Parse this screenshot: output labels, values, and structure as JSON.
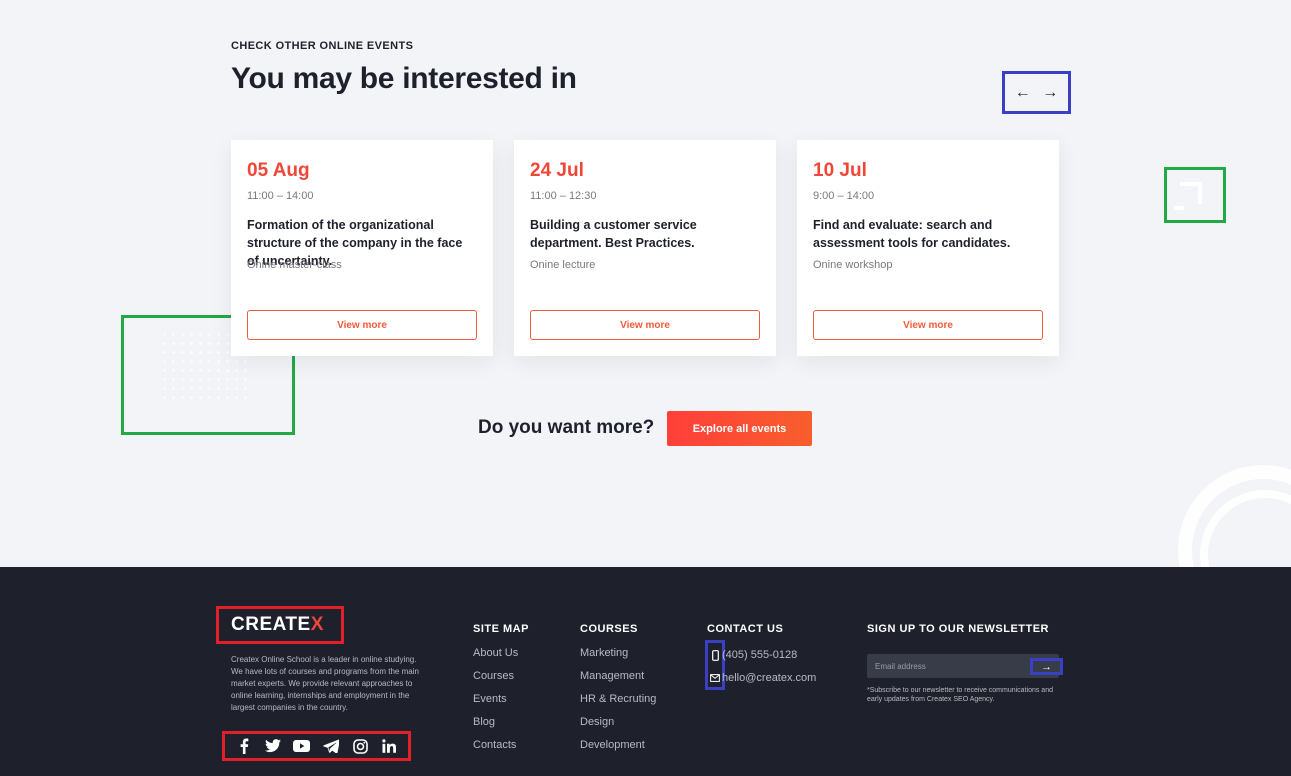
{
  "events_section": {
    "eyebrow": "CHECK OTHER ONLINE EVENTS",
    "heading": "You may be interested in",
    "nav": {
      "prev_icon": "←",
      "next_icon": "→"
    },
    "cards": [
      {
        "date": "05 Aug",
        "time": "11:00 – 14:00",
        "title": "Formation of the organizational structure of the company in the face of uncertainty.",
        "type": "Onine master-class",
        "button": "View more"
      },
      {
        "date": "24 Jul",
        "time": "11:00 – 12:30",
        "title": "Building a customer service department. Best Practices.",
        "type": "Onine lecture",
        "button": "View more"
      },
      {
        "date": "10 Jul",
        "time": "9:00 – 14:00",
        "title": "Find and evaluate: search and assessment tools for candidates.",
        "type": "Onine workshop",
        "button": "View more"
      }
    ],
    "more_question": "Do you want more?",
    "explore_button": "Explore all events"
  },
  "footer": {
    "logo_main": "CREATE",
    "logo_x": "X",
    "about": "Createx Online School is a leader in online studying. We have lots of courses and programs from the main market experts. We provide relevant approaches to online learning, internships and employment in the largest companies in the country.",
    "social": [
      "facebook-icon",
      "twitter-icon",
      "youtube-icon",
      "telegram-icon",
      "instagram-icon",
      "linkedin-icon"
    ],
    "site_map": {
      "title": "SITE MAP",
      "items": [
        "About Us",
        "Courses",
        "Events",
        "Blog",
        "Contacts"
      ]
    },
    "courses": {
      "title": "COURSES",
      "items": [
        "Marketing",
        "Management",
        "HR & Recruting",
        "Design",
        "Development"
      ]
    },
    "contact": {
      "title": "CONTACT US",
      "phone": "(405) 555-0128",
      "email": "hello@createx.com"
    },
    "newsletter": {
      "title": "SIGN UP TO OUR NEWSLETTER",
      "placeholder": "Email address",
      "submit_icon": "→",
      "note": "*Subscribe to our newsletter to receive communications and early updates from Createx SEO Agency."
    }
  },
  "colors": {
    "accent": "#ef4637",
    "dark": "#1e212c",
    "highlight_blue": "#3a3fc4",
    "highlight_green": "#22a845",
    "highlight_red": "#e1202a"
  }
}
